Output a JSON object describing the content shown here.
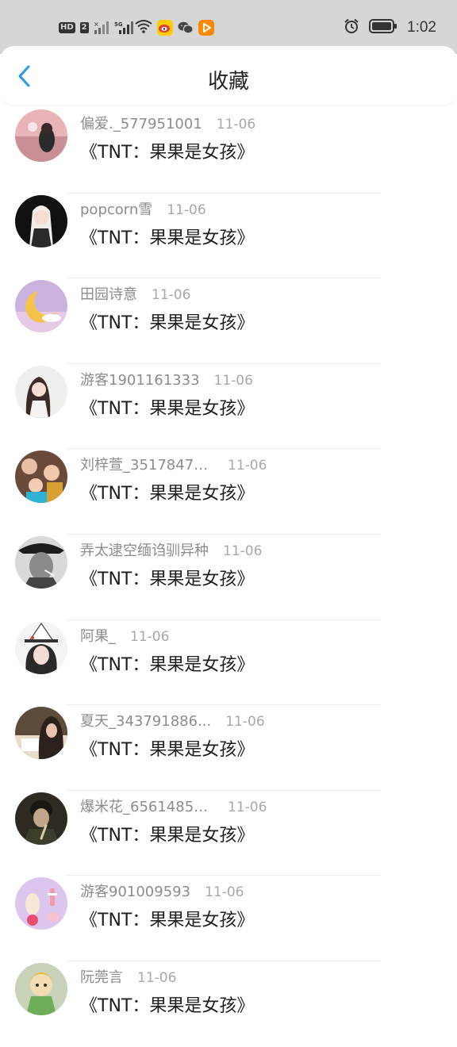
{
  "status_bar": {
    "hd": "HD",
    "sim": "2",
    "net": "5G",
    "time": "1:02"
  },
  "header": {
    "title": "收藏"
  },
  "items": [
    {
      "author": "偏爱._577951001",
      "date": "11-06",
      "book": "《TNT：果果是女孩》"
    },
    {
      "author": "popcorn雪",
      "date": "11-06",
      "book": "《TNT：果果是女孩》"
    },
    {
      "author": "田园诗意",
      "date": "11-06",
      "book": "《TNT：果果是女孩》"
    },
    {
      "author": "游客1901161333",
      "date": "11-06",
      "book": "《TNT：果果是女孩》"
    },
    {
      "author": "刘梓萱_35178477...",
      "date": "11-06",
      "book": "《TNT：果果是女孩》"
    },
    {
      "author": "弄太逮空缅诌驯异种",
      "date": "11-06",
      "book": "《TNT：果果是女孩》"
    },
    {
      "author": "阿果_",
      "date": "11-06",
      "book": "《TNT：果果是女孩》"
    },
    {
      "author": "夏天_343791886...",
      "date": "11-06",
      "book": "《TNT：果果是女孩》"
    },
    {
      "author": "爆米花_65614850...",
      "date": "11-06",
      "book": "《TNT：果果是女孩》"
    },
    {
      "author": "游客901009593",
      "date": "11-06",
      "book": "《TNT：果果是女孩》"
    },
    {
      "author": "阮莞言",
      "date": "11-06",
      "book": "《TNT：果果是女孩》"
    }
  ],
  "colors": {
    "accent": "#2a9ae8",
    "status_bar_bg": "#d6d6d6"
  }
}
